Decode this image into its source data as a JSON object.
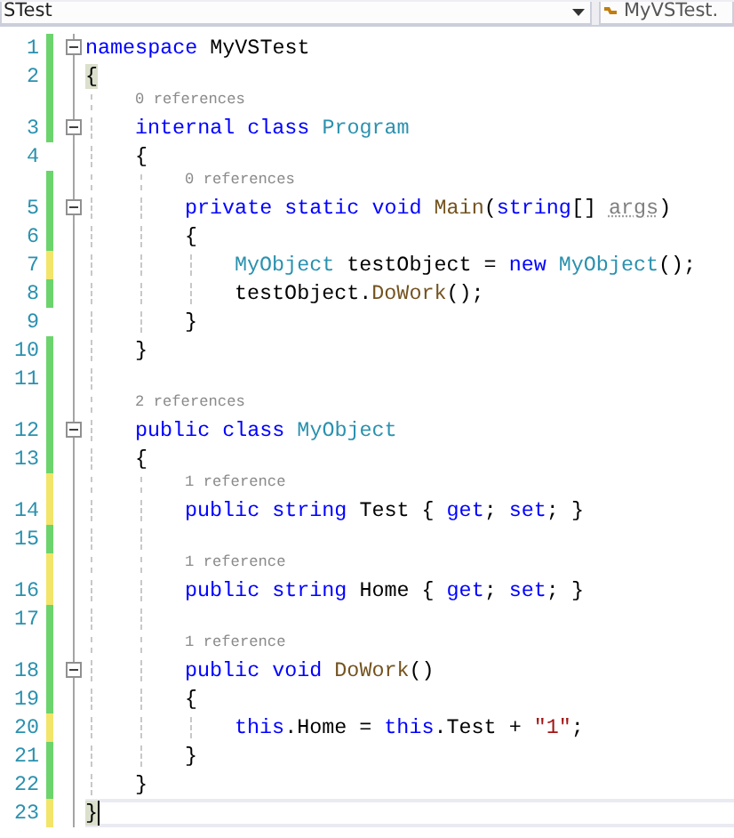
{
  "toolbar": {
    "project": "STest",
    "member": "MyVSTest."
  },
  "lines": [
    {
      "kind": "code",
      "number": "1",
      "tracked": true,
      "modified": false,
      "collapsible": true,
      "tokens": [
        {
          "kind": "kw",
          "text": "namespace"
        },
        {
          "kind": "text",
          "text": " MyVSTest"
        }
      ]
    },
    {
      "kind": "code",
      "number": "2",
      "tracked": true,
      "modified": false,
      "collapsible": false,
      "tokens": [
        {
          "kind": "text",
          "text": "{",
          "matched": true
        }
      ],
      "children": [
        {
          "kind": "lens",
          "tracked": true,
          "modified": false,
          "text": "0 references"
        },
        {
          "kind": "code",
          "number": "3",
          "tracked": true,
          "modified": false,
          "collapsible": true,
          "tokens": [
            {
              "kind": "kw",
              "text": "internal class"
            },
            {
              "kind": "type",
              "text": " Program"
            }
          ]
        },
        {
          "kind": "code",
          "number": "4",
          "tracked": false,
          "collapsible": false,
          "tokens": [
            {
              "kind": "text",
              "text": "{"
            }
          ],
          "children": [
            {
              "kind": "lens",
              "tracked": true,
              "modified": false,
              "text": "0 references"
            },
            {
              "kind": "code",
              "number": "5",
              "tracked": true,
              "modified": false,
              "collapsible": true,
              "tokens": [
                {
                  "kind": "kw",
                  "text": "private static void"
                },
                {
                  "kind": "method",
                  "text": " Main"
                },
                {
                  "kind": "text",
                  "text": "("
                },
                {
                  "kind": "kw",
                  "text": "string"
                },
                {
                  "kind": "text",
                  "text": "[] "
                },
                {
                  "kind": "unused",
                  "text": "args"
                },
                {
                  "kind": "text",
                  "text": ")"
                }
              ]
            },
            {
              "kind": "code",
              "number": "6",
              "tracked": true,
              "modified": false,
              "collapsible": false,
              "tokens": [
                {
                  "kind": "text",
                  "text": "{"
                }
              ],
              "children": [
                {
                  "kind": "code",
                  "number": "7",
                  "tracked": true,
                  "modified": true,
                  "collapsible": false,
                  "tokens": [
                    {
                      "kind": "type",
                      "text": "MyObject"
                    },
                    {
                      "kind": "text",
                      "text": " testObject = "
                    },
                    {
                      "kind": "kw",
                      "text": "new"
                    },
                    {
                      "kind": "type",
                      "text": " MyObject"
                    },
                    {
                      "kind": "text",
                      "text": "();"
                    }
                  ]
                },
                {
                  "kind": "code",
                  "number": "8",
                  "tracked": true,
                  "modified": false,
                  "collapsible": false,
                  "tokens": [
                    {
                      "kind": "text",
                      "text": "testObject."
                    },
                    {
                      "kind": "method",
                      "text": "DoWork"
                    },
                    {
                      "kind": "text",
                      "text": "();"
                    }
                  ]
                }
              ]
            },
            {
              "kind": "code",
              "number": "9",
              "tracked": false,
              "collapsible": false,
              "tokens": [
                {
                  "kind": "text",
                  "text": "}"
                }
              ]
            }
          ]
        },
        {
          "kind": "code",
          "number": "10",
          "tracked": true,
          "modified": false,
          "collapsible": false,
          "tokens": [
            {
              "kind": "text",
              "text": "}"
            }
          ]
        },
        {
          "kind": "code",
          "number": "11",
          "tracked": true,
          "modified": false,
          "collapsible": false
        },
        {
          "kind": "lens",
          "tracked": true,
          "modified": false,
          "text": "2 references"
        },
        {
          "kind": "code",
          "number": "12",
          "tracked": true,
          "modified": false,
          "collapsible": true,
          "tokens": [
            {
              "kind": "kw",
              "text": "public class"
            },
            {
              "kind": "type",
              "text": " MyObject"
            }
          ]
        },
        {
          "kind": "code",
          "number": "13",
          "tracked": true,
          "modified": false,
          "collapsible": false,
          "tokens": [
            {
              "kind": "text",
              "text": "{"
            }
          ],
          "children": [
            {
              "kind": "lens",
              "tracked": true,
              "modified": true,
              "text": "1 reference"
            },
            {
              "kind": "code",
              "number": "14",
              "tracked": true,
              "modified": true,
              "collapsible": false,
              "tokens": [
                {
                  "kind": "kw",
                  "text": "public string"
                },
                {
                  "kind": "text",
                  "text": " Test { "
                },
                {
                  "kind": "kw",
                  "text": "get"
                },
                {
                  "kind": "text",
                  "text": "; "
                },
                {
                  "kind": "kw",
                  "text": "set"
                },
                {
                  "kind": "text",
                  "text": "; }"
                }
              ]
            },
            {
              "kind": "code",
              "number": "15",
              "tracked": true,
              "modified": false,
              "collapsible": false
            },
            {
              "kind": "lens",
              "tracked": true,
              "modified": true,
              "text": "1 reference"
            },
            {
              "kind": "code",
              "number": "16",
              "tracked": true,
              "modified": true,
              "collapsible": false,
              "tokens": [
                {
                  "kind": "kw",
                  "text": "public string"
                },
                {
                  "kind": "text",
                  "text": " Home { "
                },
                {
                  "kind": "kw",
                  "text": "get"
                },
                {
                  "kind": "text",
                  "text": "; "
                },
                {
                  "kind": "kw",
                  "text": "set"
                },
                {
                  "kind": "text",
                  "text": "; }"
                }
              ]
            },
            {
              "kind": "code",
              "number": "17",
              "tracked": true,
              "modified": false,
              "collapsible": false
            },
            {
              "kind": "lens",
              "tracked": true,
              "modified": false,
              "text": "1 reference"
            },
            {
              "kind": "code",
              "number": "18",
              "tracked": true,
              "modified": false,
              "collapsible": true,
              "tokens": [
                {
                  "kind": "kw",
                  "text": "public void"
                },
                {
                  "kind": "method",
                  "text": " DoWork"
                },
                {
                  "kind": "text",
                  "text": "()"
                }
              ]
            },
            {
              "kind": "code",
              "number": "19",
              "tracked": true,
              "modified": false,
              "collapsible": false,
              "tokens": [
                {
                  "kind": "text",
                  "text": "{"
                }
              ],
              "children": [
                {
                  "kind": "code",
                  "number": "20",
                  "tracked": true,
                  "modified": true,
                  "collapsible": false,
                  "tokens": [
                    {
                      "kind": "kw",
                      "text": "this"
                    },
                    {
                      "kind": "text",
                      "text": ".Home = "
                    },
                    {
                      "kind": "kw",
                      "text": "this"
                    },
                    {
                      "kind": "text",
                      "text": ".Test + "
                    },
                    {
                      "kind": "string",
                      "text": "\"1\""
                    },
                    {
                      "kind": "text",
                      "text": ";"
                    }
                  ]
                }
              ]
            },
            {
              "kind": "code",
              "number": "21",
              "tracked": true,
              "modified": false,
              "collapsible": false,
              "tokens": [
                {
                  "kind": "text",
                  "text": "}"
                }
              ]
            }
          ]
        },
        {
          "kind": "code",
          "number": "22",
          "tracked": true,
          "modified": false,
          "collapsible": false,
          "tokens": [
            {
              "kind": "text",
              "text": "}"
            }
          ]
        }
      ]
    },
    {
      "kind": "code",
      "number": "23",
      "tracked": true,
      "modified": true,
      "collapsible": false,
      "current": true,
      "tokens": [
        {
          "kind": "text",
          "text": "}",
          "matched": true
        }
      ]
    }
  ]
}
